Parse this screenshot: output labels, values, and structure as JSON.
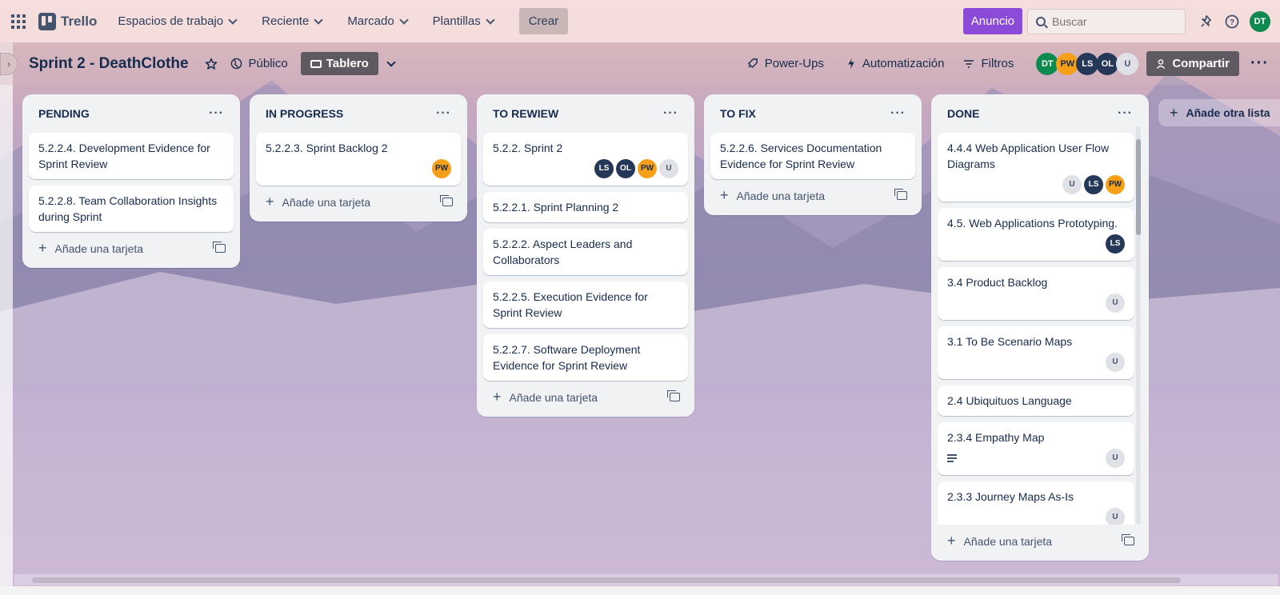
{
  "header": {
    "app_name": "Trello",
    "nav": [
      {
        "label": "Espacios de trabajo"
      },
      {
        "label": "Reciente"
      },
      {
        "label": "Marcado"
      },
      {
        "label": "Plantillas"
      }
    ],
    "create_label": "Crear",
    "announcement_label": "Anuncio",
    "search_placeholder": "Buscar",
    "user_initials": "DT"
  },
  "board": {
    "title": "Sprint 2 - DeathClothe",
    "visibility_label": "Público",
    "view_label": "Tablero",
    "powerups_label": "Power-Ups",
    "automation_label": "Automatización",
    "filters_label": "Filtros",
    "share_label": "Compartir",
    "members": [
      "DT",
      "PW",
      "LS",
      "OL",
      "U"
    ],
    "add_list_label": "Añade otra lista",
    "add_card_label": "Añade una tarjeta"
  },
  "lists": [
    {
      "title": "PENDING",
      "cards": [
        {
          "title": "5.2.2.4. Development Evidence for Sprint Review",
          "members": []
        },
        {
          "title": "5.2.2.8. Team Collaboration Insights during Sprint",
          "members": []
        }
      ]
    },
    {
      "title": "IN PROGRESS",
      "cards": [
        {
          "title": "5.2.2.3. Sprint Backlog 2",
          "members": [
            "PW"
          ]
        }
      ]
    },
    {
      "title": "TO REWIEW",
      "cards": [
        {
          "title": "5.2.2. Sprint 2",
          "members": [
            "LS",
            "OL",
            "PW",
            "U"
          ]
        },
        {
          "title": "5.2.2.1. Sprint Planning 2",
          "members": []
        },
        {
          "title": "5.2.2.2. Aspect Leaders and Collaborators",
          "members": []
        },
        {
          "title": "5.2.2.5. Execution Evidence for Sprint Review",
          "members": []
        },
        {
          "title": "5.2.2.7. Software Deployment Evidence for Sprint Review",
          "members": []
        }
      ]
    },
    {
      "title": "TO FIX",
      "cards": [
        {
          "title": "5.2.2.6. Services Documentation Evidence for Sprint Review",
          "members": []
        }
      ]
    },
    {
      "title": "DONE",
      "cards": [
        {
          "title": "4.4.4 Web Application User Flow Diagrams",
          "members": [
            "U",
            "LS",
            "PW"
          ]
        },
        {
          "title": "4.5. Web Applications Prototyping.",
          "members": [
            "LS"
          ]
        },
        {
          "title": "3.4 Product Backlog",
          "members": [
            "U"
          ]
        },
        {
          "title": "3.1 To Be Scenario Maps",
          "members": [
            "U"
          ]
        },
        {
          "title": "2.4 Ubiquituos Language",
          "members": []
        },
        {
          "title": "2.3.4 Empathy Map",
          "members": [
            "U"
          ]
        },
        {
          "title": "2.3.3 Journey Maps As-Is",
          "members": [
            "U"
          ]
        }
      ]
    }
  ],
  "colors": {
    "accent_purple": "#8b4bd8",
    "avatar_dark": "#253858",
    "avatar_orange": "#f6a01a",
    "avatar_green": "#0f8a4f",
    "list_bg": "#f1f2f4"
  }
}
